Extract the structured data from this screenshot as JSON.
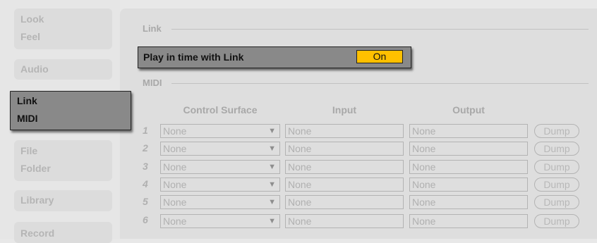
{
  "sidebar": {
    "tabs": [
      {
        "lines": [
          "Look",
          "Feel"
        ]
      },
      {
        "lines": [
          "Audio"
        ]
      },
      {
        "lines": [
          "Link",
          "MIDI"
        ],
        "active": true
      },
      {
        "lines": [
          "File",
          "Folder"
        ]
      },
      {
        "lines": [
          "Library"
        ]
      },
      {
        "lines": [
          "Record"
        ]
      }
    ]
  },
  "link_section": {
    "title": "Link",
    "play_in_time_label": "Play in time with Link",
    "toggle_value": "On"
  },
  "midi_section": {
    "title": "MIDI",
    "columns": {
      "control_surface": "Control Surface",
      "input": "Input",
      "output": "Output"
    },
    "rows": [
      {
        "number": "1",
        "control_surface": "None",
        "input": "None",
        "output": "None",
        "dump": "Dump"
      },
      {
        "number": "2",
        "control_surface": "None",
        "input": "None",
        "output": "None",
        "dump": "Dump"
      },
      {
        "number": "3",
        "control_surface": "None",
        "input": "None",
        "output": "None",
        "dump": "Dump"
      },
      {
        "number": "4",
        "control_surface": "None",
        "input": "None",
        "output": "None",
        "dump": "Dump"
      },
      {
        "number": "5",
        "control_surface": "None",
        "input": "None",
        "output": "None",
        "dump": "Dump"
      },
      {
        "number": "6",
        "control_surface": "None",
        "input": "None",
        "output": "None",
        "dump": "Dump"
      }
    ]
  },
  "colors": {
    "toggle_on": "#ffc000",
    "active_tab": "#898989"
  }
}
